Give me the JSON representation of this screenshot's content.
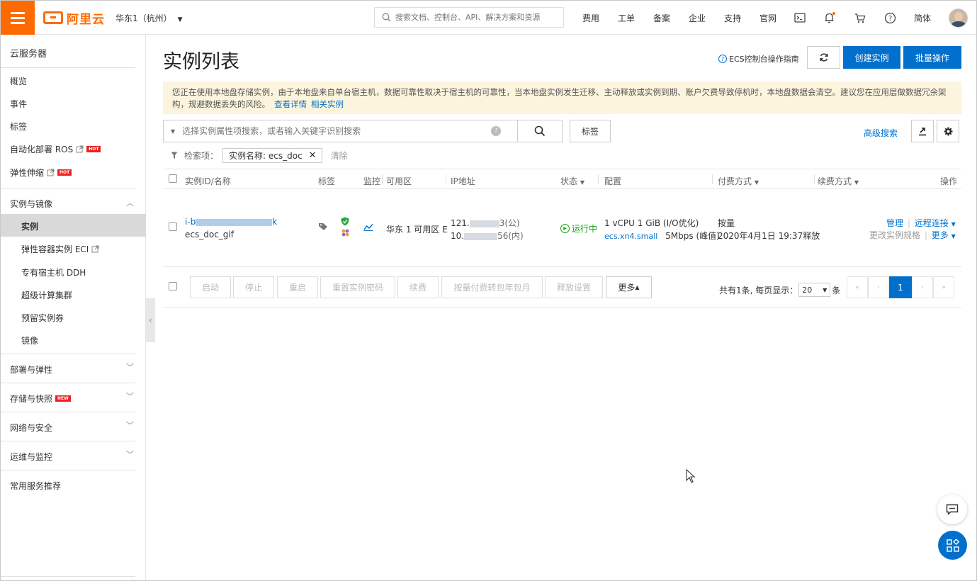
{
  "brand": {
    "name": "阿里云",
    "accent": "#ff6a00",
    "primary": "#0070cc"
  },
  "header": {
    "region": "华东1（杭州）",
    "search_placeholder": "搜索文档、控制台、API、解决方案和资源",
    "links": [
      "费用",
      "工单",
      "备案",
      "企业",
      "支持",
      "官网"
    ],
    "icons": [
      "terminal-icon",
      "bell-icon",
      "cart-icon",
      "help-icon"
    ],
    "language": "简体"
  },
  "sidebar": {
    "title": "云服务器",
    "items": [
      {
        "label": "概览"
      },
      {
        "label": "事件"
      },
      {
        "label": "标签"
      },
      {
        "label": "自动化部署 ROS",
        "badge": "HOT"
      },
      {
        "label": "弹性伸缩",
        "badge": "HOT"
      }
    ],
    "group_instances": {
      "label": "实例与镜像",
      "children": [
        {
          "label": "实例"
        },
        {
          "label": "弹性容器实例 ECI"
        },
        {
          "label": "专有宿主机 DDH"
        },
        {
          "label": "超级计算集群"
        },
        {
          "label": "预留实例券"
        },
        {
          "label": "镜像"
        }
      ]
    },
    "groups": [
      {
        "label": "部署与弹性"
      },
      {
        "label": "存储与快照",
        "badge": "NEW"
      },
      {
        "label": "网络与安全"
      },
      {
        "label": "运维与监控"
      }
    ],
    "footer": "常用服务推荐"
  },
  "main": {
    "title": "实例列表",
    "guide_link": "ECS控制台操作指南",
    "create_button": "创建实例",
    "batch_button": "批量操作",
    "notice": {
      "text": "您正在使用本地盘存储实例，由于本地盘来自单台宿主机，数据可靠性取决于宿主机的可靠性，当本地盘实例发生迁移、主动释放或实例到期、账户欠费导致停机时，本地盘数据会清空。建议您在应用层做数据冗余架构，规避数据丢失的风险。",
      "link1": "查看详情",
      "link2": "相关实例"
    },
    "filter": {
      "placeholder": "选择实例属性项搜索，或者输入关键字识别搜索",
      "tag_button": "标签",
      "advanced": "高级搜索",
      "criteria_label": "检索项：",
      "chip": "实例名称: ecs_doc",
      "clear": "清除"
    },
    "table": {
      "columns": {
        "id": "实例ID/名称",
        "tag": "标签",
        "monitor": "监控",
        "zone": "可用区",
        "ip": "IP地址",
        "status": "状态",
        "config": "配置",
        "billing": "付费方式",
        "renew": "续费方式",
        "actions": "操作"
      },
      "row": {
        "id_prefix": "i-b",
        "id_suffix": "k",
        "name": "ecs_doc_gif",
        "zone": "华东 1 可用区 E",
        "ip_public_prefix": "121.",
        "ip_public_suffix": "3(公)",
        "ip_private_prefix": "10.",
        "ip_private_suffix": "56(内)",
        "status": "运行中",
        "config_line1": "1 vCPU 1 GiB (I/O优化)",
        "config_type": "ecs.xn4.small",
        "config_bw": "5Mbps (峰值)",
        "billing_line1": "按量",
        "billing_line2": "2020年4月1日 19:37释放",
        "action_manage": "管理",
        "action_remote": "远程连接",
        "action_change": "更改实例规格",
        "action_more": "更多"
      },
      "footer_buttons": [
        "启动",
        "停止",
        "重启",
        "重置实例密码",
        "续费",
        "按量付费转包年包月",
        "释放设置"
      ],
      "more_button": "更多",
      "pagination": {
        "summary_before": "共有1条, 每页显示：",
        "page_size": "20",
        "summary_after": "条",
        "current_page": "1"
      }
    }
  }
}
